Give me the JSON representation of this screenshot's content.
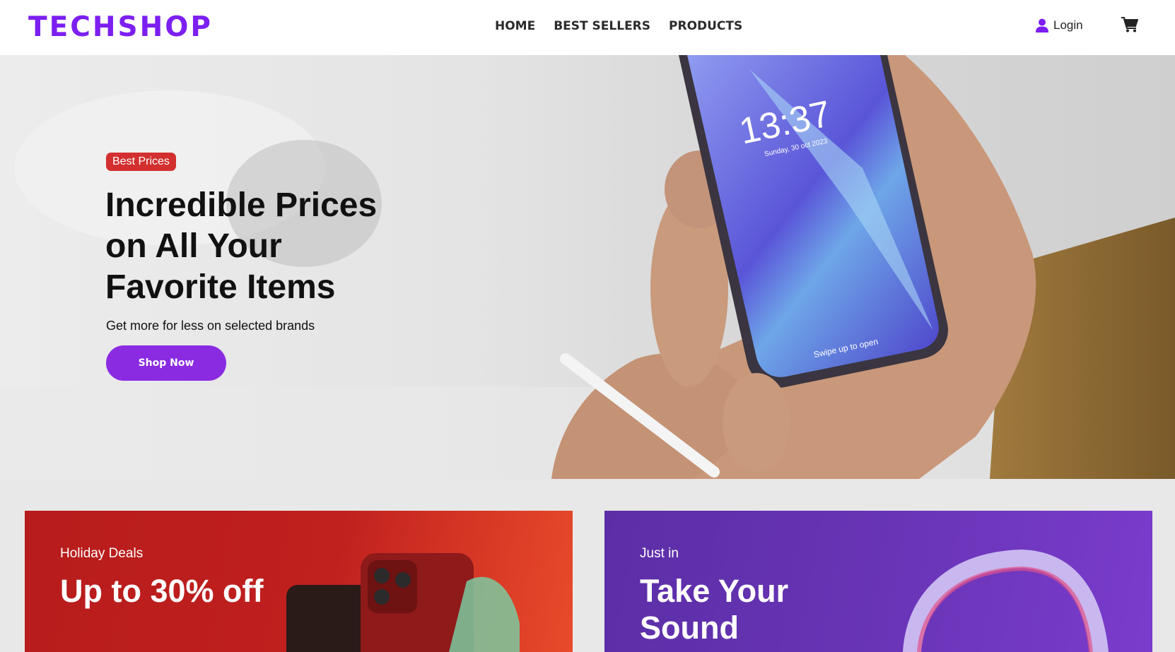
{
  "header": {
    "logo": "TECHSHOP",
    "nav": [
      "HOME",
      "BEST SELLERS",
      "PRODUCTS"
    ],
    "login_label": "Login"
  },
  "hero": {
    "badge": "Best Prices",
    "title": "Incredible Prices on All Your Favorite Items",
    "subtitle": "Get more for less on selected brands",
    "cta": "Shop Now",
    "phone_time": "13:37",
    "phone_date": "Sunday, 30 oct 2023",
    "phone_swipe": "Swipe up to open"
  },
  "promos": [
    {
      "kicker": "Holiday Deals",
      "title": "Up to 30% off"
    },
    {
      "kicker": "Just in",
      "title": "Take Your Sound"
    }
  ],
  "colors": {
    "brand": "#7c1ff0",
    "cta": "#8a2be2",
    "badge": "#d32f2f",
    "promo_red": "#b71c1c",
    "promo_purple": "#5b2ea6"
  }
}
